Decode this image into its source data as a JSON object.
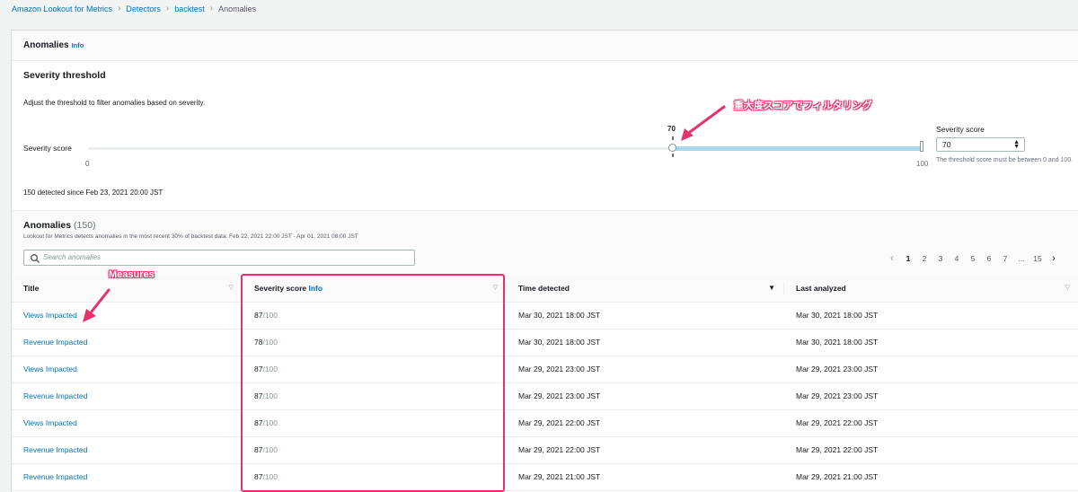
{
  "breadcrumb": {
    "items": [
      "Amazon Lookout for Metrics",
      "Detectors",
      "backtest"
    ],
    "current": "Anomalies"
  },
  "panel": {
    "title": "Anomalies",
    "info": "Info"
  },
  "severity": {
    "title": "Severity threshold",
    "description": "Adjust the threshold to filter anomalies based on severity.",
    "slider_label": "Severity score",
    "value": 70,
    "value_text": "70",
    "min": "0",
    "max": "100",
    "score_label": "Severity score",
    "score_input_value": "70",
    "score_hint": "The threshold score must be between 0 and 100.",
    "detected_text": "150 detected since Feb 23, 2021 20:00 JST"
  },
  "anomalies": {
    "title": "Anomalies",
    "count": "(150)",
    "description": "Lookout for Metrics detects anomalies in the most recent 30% of backtest data: Feb 22, 2021 22:00 JST - Apr 01, 2021 08:00 JST",
    "search_placeholder": "Search anomalies",
    "pagination": [
      "1",
      "2",
      "3",
      "4",
      "5",
      "6",
      "7",
      "...",
      "15"
    ],
    "active_page": "1",
    "columns": {
      "title": "Title",
      "severity": "Severity score",
      "severity_info": "Info",
      "time_detected": "Time detected",
      "last_analyzed": "Last analyzed"
    },
    "rows": [
      {
        "title": "Views Impacted",
        "score": "87",
        "denom": "/100",
        "time": "Mar 30, 2021 18:00 JST",
        "analyzed": "Mar 30, 2021 18:00 JST"
      },
      {
        "title": "Revenue Impacted",
        "score": "78",
        "denom": "/100",
        "time": "Mar 30, 2021 18:00 JST",
        "analyzed": "Mar 30, 2021 18:00 JST"
      },
      {
        "title": "Views Impacted",
        "score": "87",
        "denom": "/100",
        "time": "Mar 29, 2021 23:00 JST",
        "analyzed": "Mar 29, 2021 23:00 JST"
      },
      {
        "title": "Revenue Impacted",
        "score": "87",
        "denom": "/100",
        "time": "Mar 29, 2021 23:00 JST",
        "analyzed": "Mar 29, 2021 23:00 JST"
      },
      {
        "title": "Views Impacted",
        "score": "87",
        "denom": "/100",
        "time": "Mar 29, 2021 22:00 JST",
        "analyzed": "Mar 29, 2021 22:00 JST"
      },
      {
        "title": "Revenue Impacted",
        "score": "87",
        "denom": "/100",
        "time": "Mar 29, 2021 22:00 JST",
        "analyzed": "Mar 29, 2021 22:00 JST"
      },
      {
        "title": "Revenue Impacted",
        "score": "87",
        "denom": "/100",
        "time": "Mar 29, 2021 21:00 JST",
        "analyzed": "Mar 29, 2021 21:00 JST"
      }
    ]
  },
  "annotations": {
    "filter_note": "重大度スコアでフィルタリング",
    "measures_note": "Measures",
    "color": "#e8306a"
  },
  "colors": {
    "link": "#0073bb",
    "slider_fill": "#a8d8f0",
    "background": "#f2f3f3"
  }
}
